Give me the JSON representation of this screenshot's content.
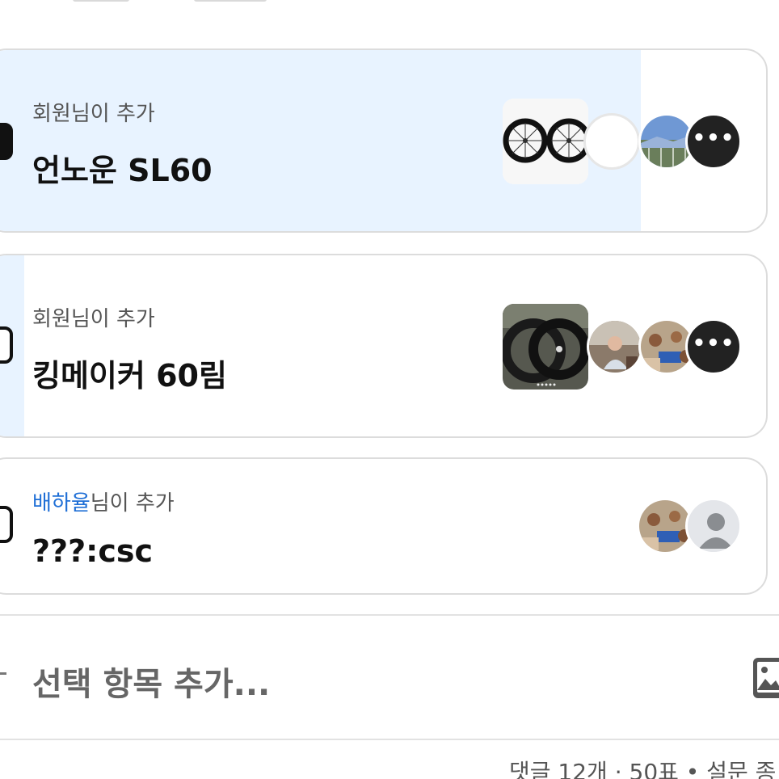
{
  "options": [
    {
      "added_by_user": "",
      "added_by_suffix": "회원님이 추가",
      "title": "언노운 SL60",
      "selected": true,
      "vote_fill_percent": 84,
      "has_image": true,
      "voter_avatars": [
        "avatar-blank",
        "avatar-photo-sky",
        "more-voters-icon"
      ],
      "more_label": "•••"
    },
    {
      "added_by_user": "",
      "added_by_suffix": "회원님이 추가",
      "title": "킹메이커 60림",
      "selected": false,
      "vote_fill_percent": 5,
      "has_image": true,
      "voter_avatars": [
        "avatar-photo-person",
        "avatar-photo-group",
        "more-voters-icon"
      ],
      "more_label": "•••"
    },
    {
      "added_by_user": "배하율",
      "added_by_suffix": "님이 추가",
      "title": "???:csc",
      "selected": false,
      "vote_fill_percent": 0,
      "has_image": false,
      "voter_avatars": [
        "avatar-photo-group",
        "default-user-icon"
      ]
    }
  ],
  "add_option": {
    "placeholder": "선택 항목 추가...",
    "icon": "image-icon"
  },
  "footer": {
    "stats": "댓글 12개 · 50표 • 설문 종"
  },
  "colors": {
    "selected_fill": "#e8f3ff",
    "link_blue": "#1f6fd6",
    "card_border": "#dcdcdc"
  }
}
